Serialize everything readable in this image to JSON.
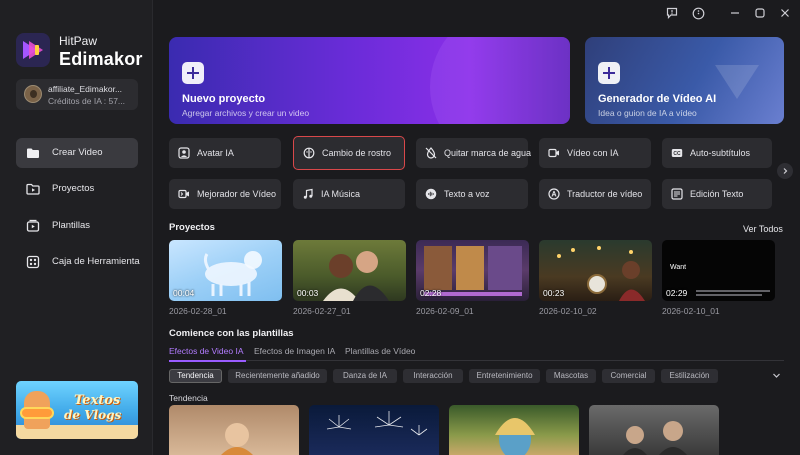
{
  "brand": {
    "top": "HitPaw",
    "name": "Edimakor"
  },
  "account": {
    "name": "affiliate_Edimakor...",
    "credits": "Créditos de IA : 57..."
  },
  "nav": [
    {
      "label": "Crear Video",
      "icon": "folder-icon"
    },
    {
      "label": "Proyectos",
      "icon": "folder-play-icon"
    },
    {
      "label": "Plantillas",
      "icon": "template-icon"
    },
    {
      "label": "Caja de Herramienta",
      "icon": "toolbox-icon"
    }
  ],
  "promo": {
    "line1": "Textos",
    "line2": "de Vlogs"
  },
  "hero": {
    "new_project": {
      "title": "Nuevo proyecto",
      "subtitle": "Agregar archivos y crear un video"
    },
    "ai_generator": {
      "title": "Generador de Vídeo AI",
      "subtitle": "Idea o guion de IA a vídeo"
    }
  },
  "tools": [
    {
      "label": "Avatar IA",
      "icon": "avatar-icon"
    },
    {
      "label": "Cambio de rostro",
      "icon": "face-swap-icon",
      "selected": true
    },
    {
      "label": "Quitar marca de agua",
      "icon": "eraser-icon"
    },
    {
      "label": "Vídeo con IA",
      "icon": "video-ai-icon"
    },
    {
      "label": "Auto-subtítulos",
      "icon": "cc-icon"
    },
    {
      "label": "Mejorador de Vídeo",
      "icon": "video-enhance-icon"
    },
    {
      "label": "IA Música",
      "icon": "music-icon"
    },
    {
      "label": "Texto a voz",
      "icon": "waveform-icon"
    },
    {
      "label": "Traductor de vídeo",
      "icon": "translate-icon"
    },
    {
      "label": "Edición Texto",
      "icon": "text-edit-icon"
    }
  ],
  "projects": {
    "title": "Proyectos",
    "see_all": "Ver Todos",
    "items": [
      {
        "duration": "00:04",
        "date": "2026-02-28_01"
      },
      {
        "duration": "00:03",
        "date": "2026-02-27_01"
      },
      {
        "duration": "02:28",
        "date": "2026-02-09_01"
      },
      {
        "duration": "00:23",
        "date": "2026-02-10_02"
      },
      {
        "duration": "02:29",
        "date": "2026-02-10_01",
        "overlay_word": "Want"
      }
    ]
  },
  "templates": {
    "title": "Comience con las plantillas",
    "tabs": [
      "Efectos de Video IA",
      "Efectos de Imagen IA",
      "Plantillas de Vídeo"
    ],
    "chips": [
      "Tendencia",
      "Recientemente añadido",
      "Danza de IA",
      "Interacción",
      "Entretenimiento",
      "Mascotas",
      "Comercial",
      "Estilización"
    ],
    "row_label": "Tendencia"
  },
  "colors": {
    "accent": "#9a5cff",
    "selection_border": "#d9484a",
    "background": "#1b1b1e"
  }
}
